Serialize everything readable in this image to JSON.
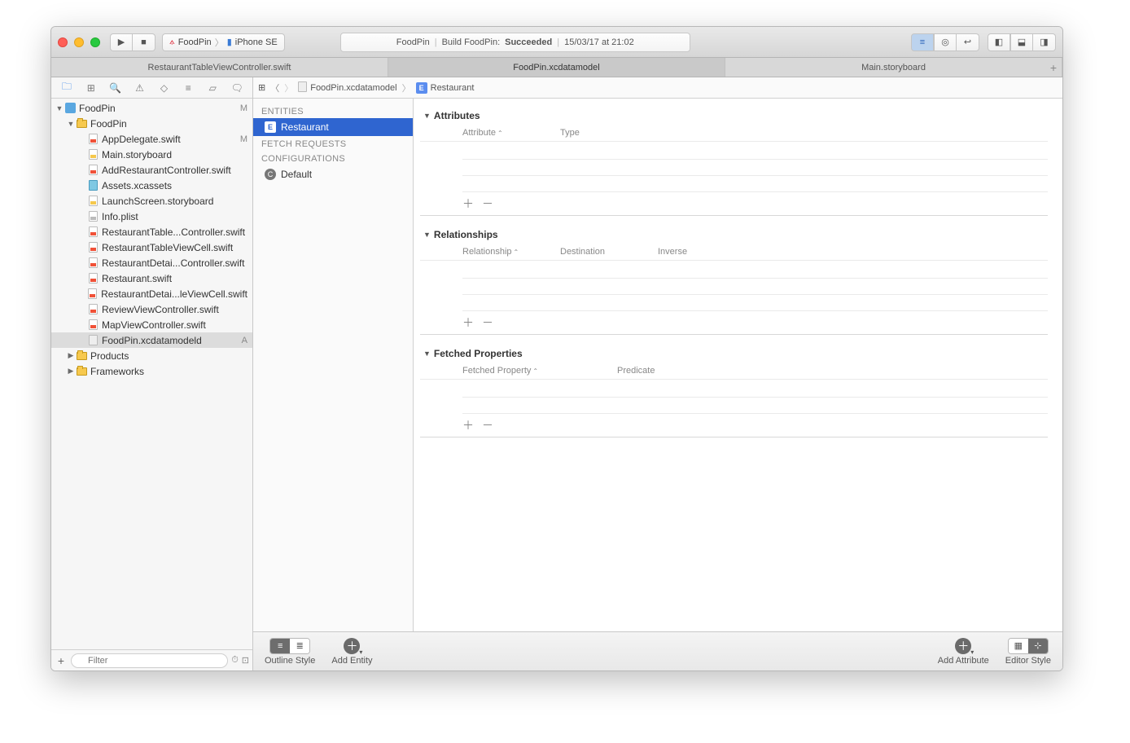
{
  "toolbar": {
    "scheme_app": "FoodPin",
    "scheme_device": "iPhone SE"
  },
  "status": {
    "project": "FoodPin",
    "action_prefix": "Build FoodPin:",
    "action_result": "Succeeded",
    "timestamp": "15/03/17 at 21:02"
  },
  "tabs": [
    "RestaurantTableViewController.swift",
    "FoodPin.xcdatamodel",
    "Main.storyboard"
  ],
  "navigator": {
    "root": "FoodPin",
    "root_badge": "M",
    "group": "FoodPin",
    "files": [
      {
        "name": "AppDelegate.swift",
        "type": "swift",
        "badge": "M"
      },
      {
        "name": "Main.storyboard",
        "type": "sb"
      },
      {
        "name": "AddRestaurantController.swift",
        "type": "swift"
      },
      {
        "name": "Assets.xcassets",
        "type": "assets"
      },
      {
        "name": "LaunchScreen.storyboard",
        "type": "sb"
      },
      {
        "name": "Info.plist",
        "type": "plist"
      },
      {
        "name": "RestaurantTable...Controller.swift",
        "type": "swift"
      },
      {
        "name": "RestaurantTableViewCell.swift",
        "type": "swift"
      },
      {
        "name": "RestaurantDetai...Controller.swift",
        "type": "swift"
      },
      {
        "name": "Restaurant.swift",
        "type": "swift"
      },
      {
        "name": "RestaurantDetai...leViewCell.swift",
        "type": "swift"
      },
      {
        "name": "ReviewViewController.swift",
        "type": "swift"
      },
      {
        "name": "MapViewController.swift",
        "type": "swift"
      },
      {
        "name": "FoodPin.xcdatamodeld",
        "type": "model",
        "badge": "A",
        "selected": true
      }
    ],
    "groups_collapsed": [
      "Products",
      "Frameworks"
    ],
    "filter_placeholder": "Filter"
  },
  "jumpbar": {
    "file": "FoodPin.xcdatamodel",
    "entity": "Restaurant"
  },
  "entities": {
    "header": "ENTITIES",
    "items": [
      "Restaurant"
    ],
    "fetch_header": "FETCH REQUESTS",
    "config_header": "CONFIGURATIONS",
    "config_items": [
      "Default"
    ]
  },
  "sections": {
    "attributes": {
      "title": "Attributes",
      "cols": [
        "Attribute",
        "Type"
      ]
    },
    "relationships": {
      "title": "Relationships",
      "cols": [
        "Relationship",
        "Destination",
        "Inverse"
      ]
    },
    "fetched": {
      "title": "Fetched Properties",
      "cols": [
        "Fetched Property",
        "Predicate"
      ]
    }
  },
  "bottom": {
    "outline": "Outline Style",
    "add_entity": "Add Entity",
    "add_attribute": "Add Attribute",
    "editor_style": "Editor Style"
  }
}
